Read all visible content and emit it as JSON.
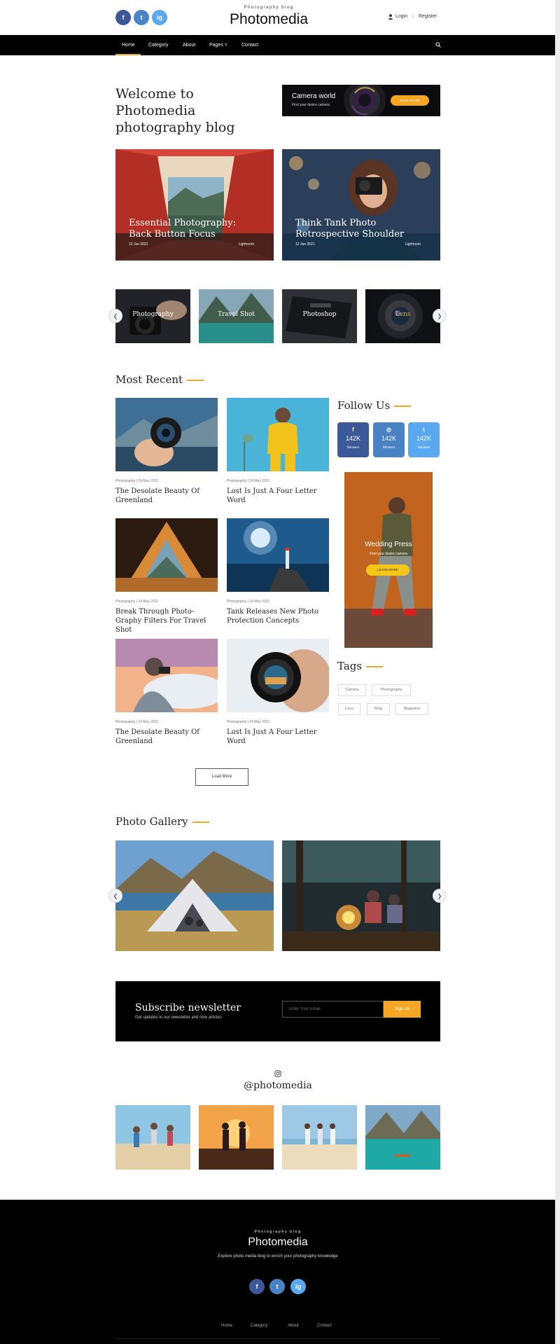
{
  "header": {
    "tagline": "Photography blog",
    "brand": "Photomedia",
    "login": "Login",
    "separator": "|",
    "register": "Register",
    "social": [
      "f",
      "t",
      "ig"
    ]
  },
  "nav": {
    "items": [
      {
        "label": "Home"
      },
      {
        "label": "Category"
      },
      {
        "label": "About"
      },
      {
        "label": "Pages ˅"
      },
      {
        "label": "Contact"
      }
    ],
    "search_icon": "search-icon"
  },
  "hero": {
    "title_line1": "Welcome to Photomedia",
    "title_line2": "photography blog",
    "banner_title": "Camera world",
    "banner_sub": "Find your desire camera",
    "banner_btn": "SHOP STORE"
  },
  "featured": [
    {
      "title": "Essential Photography: Back Button Focus",
      "date": "12 Jun 2021",
      "category": "Lightroom"
    },
    {
      "title": "Think Tank Photo Retrospective Shoulder",
      "date": "12 Jun 2021",
      "category": "Lightroom"
    }
  ],
  "categories": [
    {
      "label": "Photography"
    },
    {
      "label": "Travel Shot"
    },
    {
      "label": "Photoshop"
    },
    {
      "label": "Lens"
    }
  ],
  "most_recent": {
    "title": "Most Recent",
    "posts": [
      {
        "meta": "Photography | 24 May 2021",
        "title": "The Desolate Beauty Of Greenland"
      },
      {
        "meta": "Photography | 24 May 2021",
        "title": "Lost Is Just A Four Letter Word"
      },
      {
        "meta": "Photography | 24 May 2021",
        "title": "Break Through Photo-Graphy Filters For Travel Shot"
      },
      {
        "meta": "Photography | 24 May 2021",
        "title": "Tank Releases New Photo Protection Concepts"
      },
      {
        "meta": "Photography | 24 May 2021",
        "title": "The Desolate Beauty Of Greenland"
      },
      {
        "meta": "Photography | 24 May 2021",
        "title": "Lost Is Just A Four Letter Word"
      }
    ],
    "load_more": "Load More"
  },
  "sidebar": {
    "follow_title": "Follow Us",
    "follow": [
      {
        "icon": "f",
        "count": "142K",
        "label": "followers"
      },
      {
        "icon": "◎",
        "count": "142K",
        "label": "followers"
      },
      {
        "icon": "t",
        "count": "142K",
        "label": "followers"
      }
    ],
    "ad_title": "Wedding Press",
    "ad_sub": "Find your desire camera",
    "ad_btn": "LEARN MORE",
    "tags_title": "Tags",
    "tags": [
      "Camera",
      "Photography",
      "Lens",
      "Blog",
      "Magazine"
    ]
  },
  "gallery": {
    "title": "Photo Gallery"
  },
  "newsletter": {
    "title": "Subscribe newsletter",
    "sub": "Get updates to our newsletter and new articles",
    "placeholder": "Enter Your Email",
    "button": "Sign up"
  },
  "instagram": {
    "handle": "@photomedia"
  },
  "footer": {
    "tagline": "Photography blog",
    "brand": "Photomedia",
    "description": "Explore photo media blog to enrich your photography knowledge",
    "links": [
      "Home",
      "Category",
      "About",
      "Contact"
    ]
  },
  "colors": {
    "accent": "#f5a623",
    "dark": "#000000",
    "facebook": "#3b5998",
    "twitter": "#4a83c4",
    "instagram": "#5aa8f0"
  }
}
